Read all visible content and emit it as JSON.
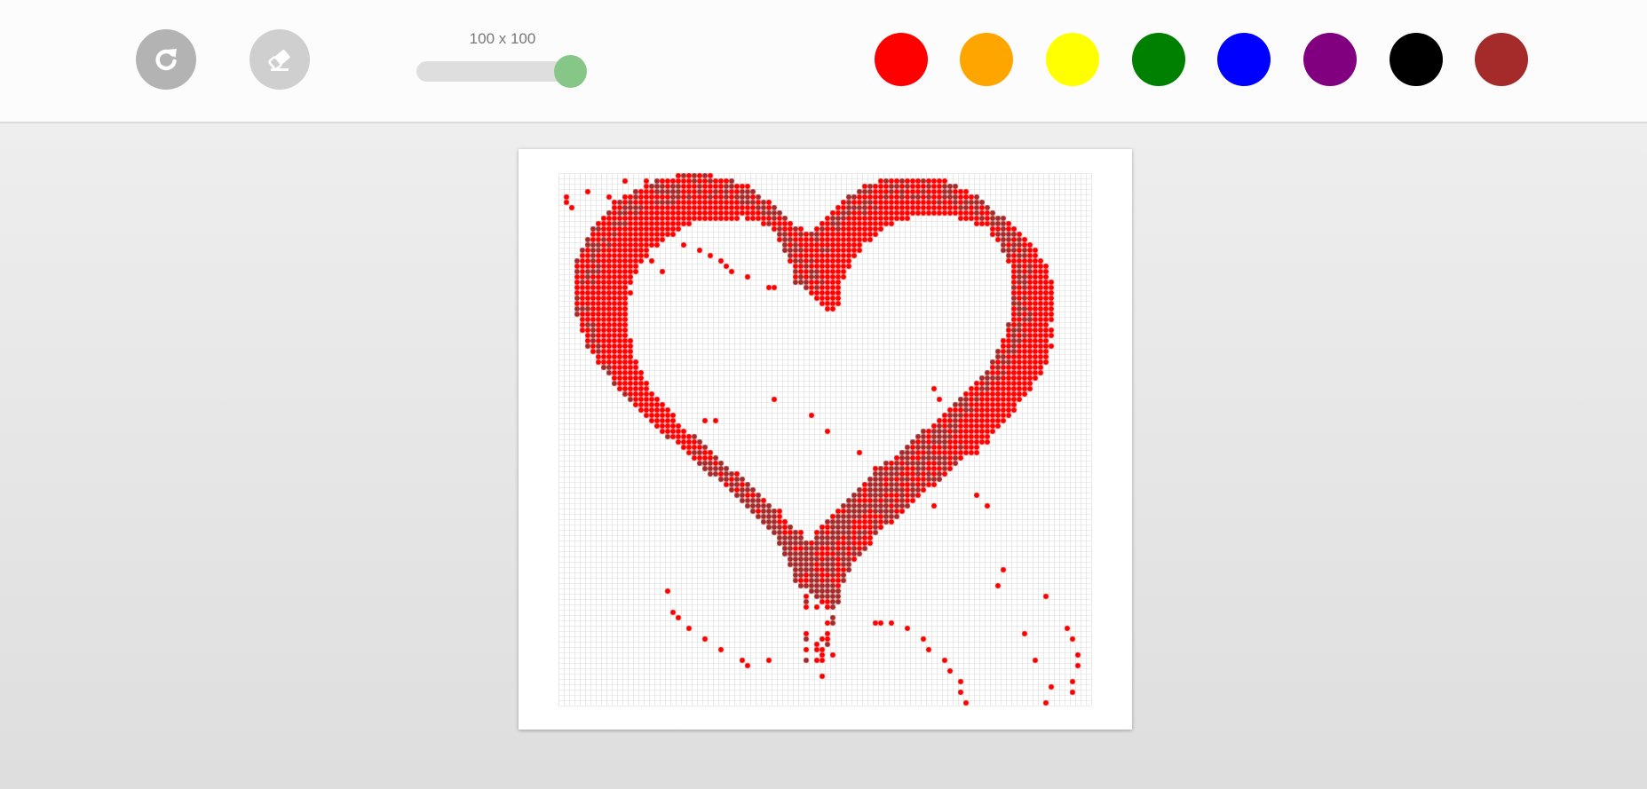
{
  "toolbar": {
    "reset_icon": "redo-icon",
    "eraser_icon": "eraser-icon",
    "grid_size_label": "100 x 100",
    "grid_size": {
      "cols": 100,
      "rows": 100
    },
    "colors": [
      {
        "name": "red",
        "hex": "#ff0000"
      },
      {
        "name": "orange",
        "hex": "#ffa500"
      },
      {
        "name": "yellow",
        "hex": "#ffff00"
      },
      {
        "name": "green",
        "hex": "#008000"
      },
      {
        "name": "blue",
        "hex": "#0000ff"
      },
      {
        "name": "purple",
        "hex": "#800080"
      },
      {
        "name": "black",
        "hex": "#000000"
      },
      {
        "name": "brown",
        "hex": "#a52a2a"
      }
    ]
  },
  "canvas": {
    "background": "#ffffff",
    "grid_line_color": "#dddddd",
    "paint_colors": [
      "#ff0000",
      "#a52a2a"
    ],
    "drawing_subject": "heart"
  }
}
